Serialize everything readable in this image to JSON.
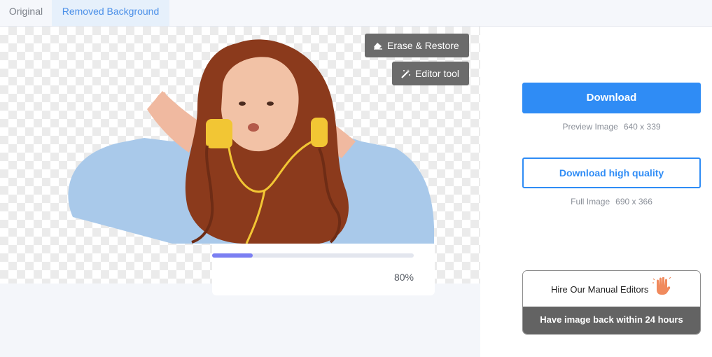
{
  "tabs": [
    {
      "label": "Original",
      "active": false
    },
    {
      "label": "Removed Background",
      "active": true
    }
  ],
  "editor": {
    "erase_restore_label": "Erase & Restore",
    "editor_tool_label": "Editor tool",
    "progress_value": 0.2,
    "progress_text": "80%"
  },
  "download": {
    "primary_label": "Download",
    "preview_caption": "Preview Image",
    "preview_size": "640 x 339",
    "hq_label": "Download high quality",
    "full_caption": "Full Image",
    "full_size": "690 x 366"
  },
  "hire": {
    "title": "Hire Our Manual Editors",
    "subtitle": "Have image back within 24 hours"
  },
  "colors": {
    "accent": "#2f8cf5",
    "progress": "#7b7ff2",
    "tool_button": "#6b6b6b",
    "hire_footer": "#636363"
  },
  "icons": {
    "erase": "eraser-icon",
    "editor": "magic-wand-icon",
    "hire": "hand-icon"
  }
}
